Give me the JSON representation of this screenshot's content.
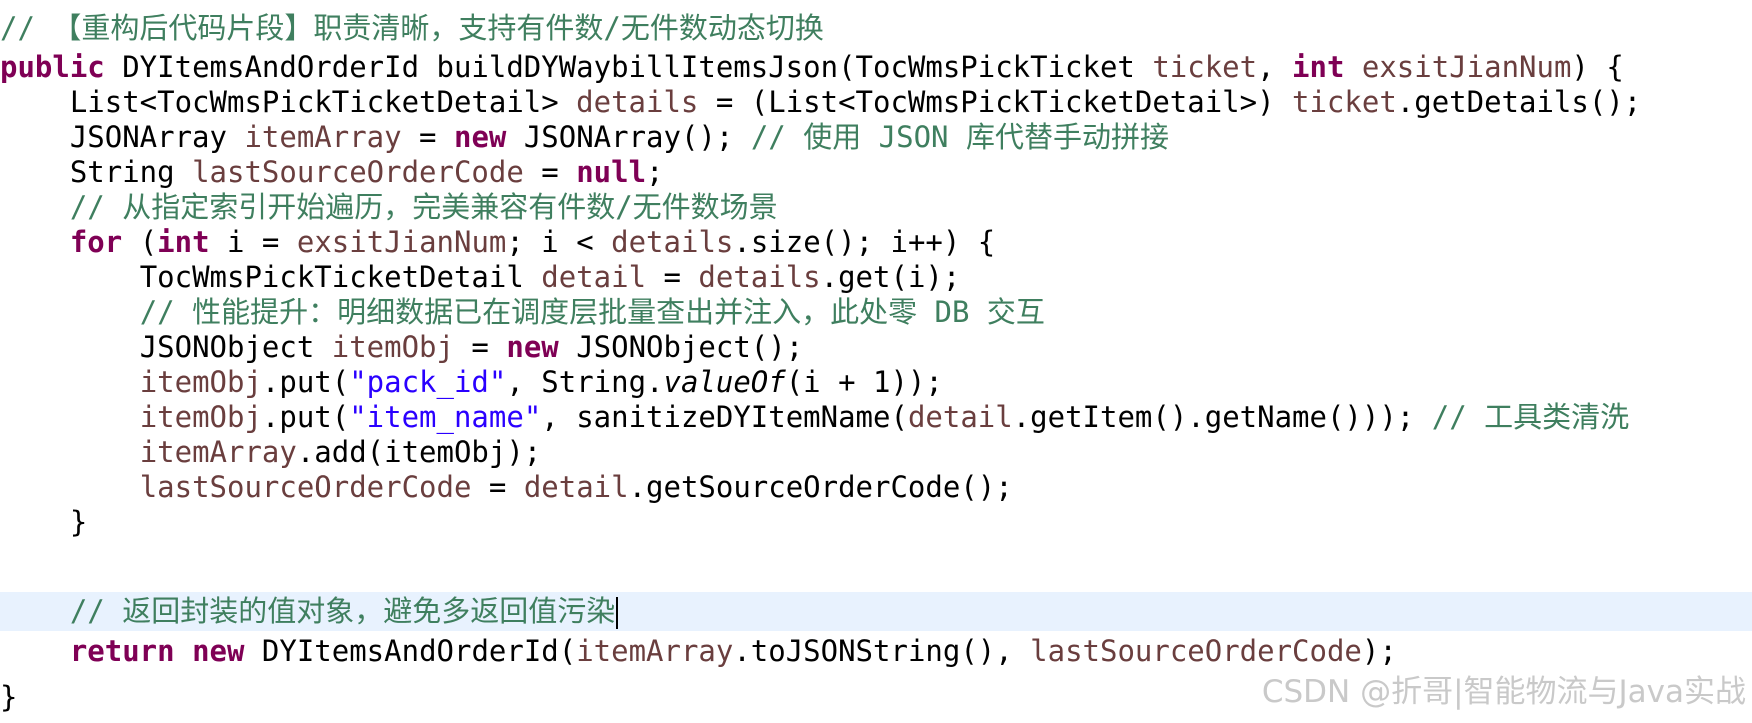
{
  "code": {
    "l1_comment": "// 【重构后代码片段】职责清晰，支持有件数/无件数动态切换",
    "l2_public": "public",
    "l2_sig_a": " DYItemsAndOrderId buildDYWaybillItemsJson(TocWmsPickTicket ",
    "l2_ticket": "ticket",
    "l2_comma": ", ",
    "l2_int": "int",
    "l2_sp": " ",
    "l2_exsit": "exsitJianNum",
    "l2_end": ") {",
    "l3_indent": "    ",
    "l3_type": "List<TocWmsPickTicketDetail> ",
    "l3_details": "details",
    "l3_mid": " = (List<TocWmsPickTicketDetail>) ",
    "l3_ticket": "ticket",
    "l3_end": ".getDetails();",
    "l4_type": "JSONArray ",
    "l4_var": "itemArray",
    "l4_eq": " = ",
    "l4_new": "new",
    "l4_rest": " JSONArray(); ",
    "l4_comment": "// 使用 JSON 库代替手动拼接",
    "l5_type": "String ",
    "l5_var": "lastSourceOrderCode",
    "l5_eq": " = ",
    "l5_null": "null",
    "l5_end": ";",
    "l6_comment": "// 从指定索引开始遍历，完美兼容有件数/无件数场景",
    "l7_for": "for",
    "l7_open": " (",
    "l7_int": "int",
    "l7_i": " i = ",
    "l7_exsit": "exsitJianNum",
    "l7_mid": "; i < ",
    "l7_details": "details",
    "l7_end": ".size(); i++) {",
    "l8_indent": "        ",
    "l8_type": "TocWmsPickTicketDetail ",
    "l8_var": "detail",
    "l8_eq": " = ",
    "l8_details": "details",
    "l8_end": ".get(i);",
    "l9_comment": "// 性能提升：明细数据已在调度层批量查出并注入，此处零 DB 交互",
    "l10_type": "JSONObject ",
    "l10_var": "itemObj",
    "l10_eq": " = ",
    "l10_new": "new",
    "l10_end": " JSONObject();",
    "l11_var": "itemObj",
    "l11_put": ".put(",
    "l11_str": "\"pack_id\"",
    "l11_mid": ", String.",
    "l11_valueof": "valueOf",
    "l11_end": "(i + 1));",
    "l12_var": "itemObj",
    "l12_put": ".put(",
    "l12_str": "\"item_name\"",
    "l12_mid": ", sanitizeDYItemName(",
    "l12_detail": "detail",
    "l12_end": ".getItem().getName())); ",
    "l12_comment": "// 工具类清洗",
    "l13_var": "itemArray",
    "l13_end": ".add(itemObj);",
    "l14_var": "lastSourceOrderCode",
    "l14_eq": " = ",
    "l14_detail": "detail",
    "l14_end": ".getSourceOrderCode();",
    "l15_brace": "}",
    "l16_comment": "// 返回封装的值对象，避免多返回值污染",
    "l17_return": "return",
    "l17_sp": " ",
    "l17_new": "new",
    "l17_mid": " DYItemsAndOrderId(",
    "l17_var1": "itemArray",
    "l17_mid2": ".toJSONString(), ",
    "l17_var2": "lastSourceOrderCode",
    "l17_end": ");",
    "l18_brace": "}"
  },
  "watermark": "CSDN @折哥|智能物流与Java实战",
  "colors": {
    "keyword": "#7f0055",
    "comment": "#3f7f5f",
    "string": "#2a00ff",
    "variable": "#6a3e3e",
    "current_line": "#e8f2fe",
    "watermark": "#c9c9c9"
  }
}
